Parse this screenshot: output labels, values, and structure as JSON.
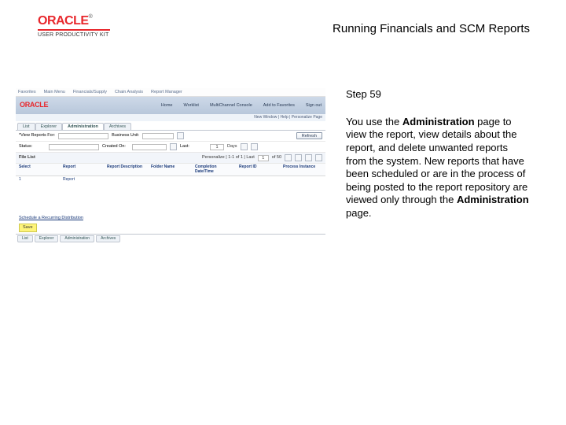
{
  "header": {
    "brand": "ORACLE",
    "tm": "®",
    "kit": "USER PRODUCTIVITY KIT",
    "title": "Running Financials and SCM Reports"
  },
  "right": {
    "step": "Step 59",
    "p1a": "You use the ",
    "p1b": "Administration",
    "p1c": " page to view the report, view details about the report, and delete unwanted reports from the system. New reports that have been scheduled or are in the process of being posted to the report repository are viewed only through the ",
    "p1d": "Administration",
    "p1e": " page."
  },
  "ss": {
    "top": {
      "fav": "Favorites",
      "menu": "Main Menu",
      "br1": "Financials/Supply",
      "br2": "Chain Analysis",
      "br3": "Report Manager",
      "btn1": "Home",
      "btn2": "Worklist",
      "btn3": "MultiChannel Console",
      "btn4": "Add to Favorites",
      "btn5": "Sign out"
    },
    "logobar": {
      "brand": "ORACLE"
    },
    "subbar": "New Window | Help | Personalize Page",
    "tabs": {
      "t1": "List",
      "t2": "Explorer",
      "t3": "Administration",
      "t4": "Archives"
    },
    "row1": {
      "lbl1": "*View Reports For:",
      "val1": "",
      "lbl2": "Business Unit:",
      "btnRefresh": "Refresh"
    },
    "row2": {
      "lbl1": "Status:",
      "lbl2": "Created On:",
      "lbl3": "Last:",
      "val3": "1",
      "unit": "Days"
    },
    "fileList": {
      "header": "File List",
      "paging": "Personalize | 1-1 of 1 | Last",
      "page": "1",
      "of": "of 50"
    },
    "grid": {
      "h1": "Select",
      "h2": "Report",
      "h3": "Report Description",
      "h4": "Folder Name",
      "h5": "Completion Date/Time",
      "h6": "Report ID",
      "h7": "Process Instance",
      "d1": "1",
      "d2": "Report"
    },
    "foot": {
      "link": "Schedule a Recurring Distribution",
      "save": "Save",
      "bt1": "List",
      "bt2": "Explorer",
      "bt3": "Administration",
      "bt4": "Archives"
    }
  }
}
